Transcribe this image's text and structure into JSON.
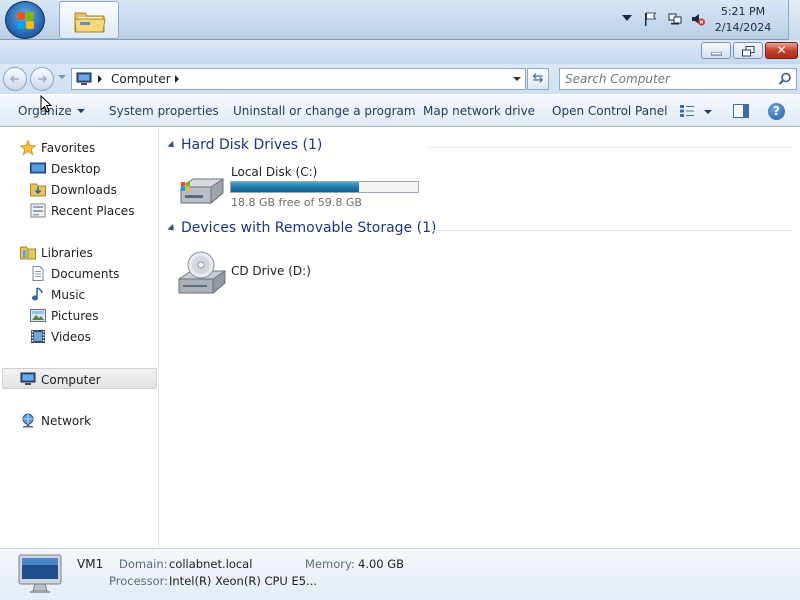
{
  "taskbar": {
    "clock_time": "5:21 PM",
    "clock_date": "2/14/2024"
  },
  "address": {
    "location": "Computer"
  },
  "search": {
    "placeholder": "Search Computer"
  },
  "toolbar": {
    "organize": "Organize",
    "system_properties": "System properties",
    "uninstall": "Uninstall or change a program",
    "map_drive": "Map network drive",
    "open_control_panel": "Open Control Panel"
  },
  "nav": {
    "favorites": "Favorites",
    "desktop": "Desktop",
    "downloads": "Downloads",
    "recent_places": "Recent Places",
    "libraries": "Libraries",
    "documents": "Documents",
    "music": "Music",
    "pictures": "Pictures",
    "videos": "Videos",
    "computer": "Computer",
    "network": "Network"
  },
  "content": {
    "hdd_header": "Hard Disk Drives (1)",
    "removable_header": "Devices with Removable Storage (1)",
    "local_disk": {
      "name": "Local Disk (C:)",
      "free_text": "18.8 GB free of 59.8 GB",
      "used_fraction": 0.686
    },
    "cd_drive": {
      "name": "CD Drive (D:)"
    }
  },
  "details": {
    "name": "VM1",
    "domain_label": "Domain:",
    "domain_value": "collabnet.local",
    "memory_label": "Memory:",
    "memory_value": "4.00 GB",
    "processor_label": "Processor:",
    "processor_value": "Intel(R) Xeon(R) CPU E5..."
  },
  "colors": {
    "accent_blue": "#1e3287",
    "disk_bar": "#2079ac",
    "close_red": "#c3432b"
  },
  "icons": {
    "start": "windows-start-orb",
    "explorer": "folder-icon",
    "search": "magnifier-icon",
    "help": "question-icon"
  }
}
